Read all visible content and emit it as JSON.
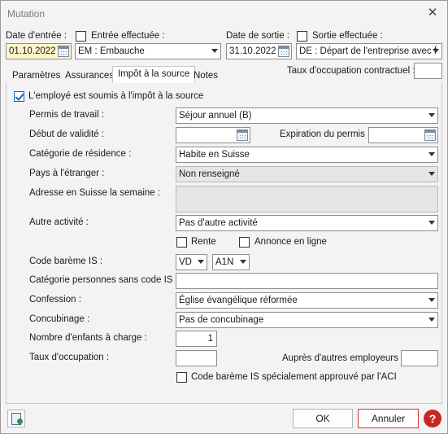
{
  "window": {
    "title": "Mutation",
    "close_glyph": "✕"
  },
  "header": {
    "date_entree_label": "Date d'entrée :",
    "date_entree_value": "01.10.2022",
    "entree_effectuee_label": "Entrée effectuée :",
    "entree_effectuee_checked": false,
    "entree_select_value": "EM : Embauche",
    "date_sortie_label": "Date de sortie :",
    "date_sortie_value": "31.10.2022",
    "sortie_effectuee_label": "Sortie effectuée :",
    "sortie_effectuee_checked": false,
    "sortie_select_value": "DE : Départ de l'entreprise avec f",
    "taux_contractuel_label": "Taux d'occupation contractuel :",
    "taux_contractuel_value": ""
  },
  "tabs": [
    {
      "label": "Paramètres",
      "active": false
    },
    {
      "label": "Assurances",
      "active": false
    },
    {
      "label": "Impôt à la source",
      "active": true
    },
    {
      "label": "Notes",
      "active": false
    }
  ],
  "impot": {
    "soumis_label": "L'employé est soumis à l'impôt à la source",
    "soumis_checked": true,
    "permis_label": "Permis de travail :",
    "permis_value": "Séjour annuel (B)",
    "debut_validite_label": "Début de validité :",
    "debut_validite_value": "",
    "expiration_label": "Expiration du permis :",
    "expiration_value": "",
    "categorie_residence_label": "Catégorie de résidence :",
    "categorie_residence_value": "Habite en Suisse",
    "pays_etranger_label": "Pays à l'étranger :",
    "pays_etranger_value": "Non renseigné",
    "adresse_suisse_label": "Adresse en Suisse la semaine :",
    "adresse_suisse_value": "",
    "autre_activite_label": "Autre activité :",
    "autre_activite_value": "Pas d'autre activité",
    "rente_label": "Rente",
    "rente_checked": false,
    "annonce_label": "Annonce en ligne",
    "annonce_checked": false,
    "code_bareme_label": "Code barème IS :",
    "code_bareme_canton": "VD",
    "code_bareme_code": "A1N",
    "categorie_sans_code_label": "Catégorie personnes sans code IS :",
    "categorie_sans_code_value": "",
    "confession_label": "Confession :",
    "confession_value": "Église évangélique réformée",
    "concubinage_label": "Concubinage :",
    "concubinage_value": "Pas de concubinage",
    "enfants_label": "Nombre d'enfants à charge :",
    "enfants_value": "1",
    "taux_occupation_label": "Taux d'occupation :",
    "taux_occupation_value": "",
    "autres_employeurs_label": "Auprès d'autres employeurs :",
    "autres_employeurs_value": "",
    "bareme_approuve_label": "Code barème IS spécialement approuvé par l'ACI",
    "bareme_approuve_checked": false
  },
  "footer": {
    "ok_label": "OK",
    "annuler_label": "Annuler",
    "help_glyph": "?"
  }
}
